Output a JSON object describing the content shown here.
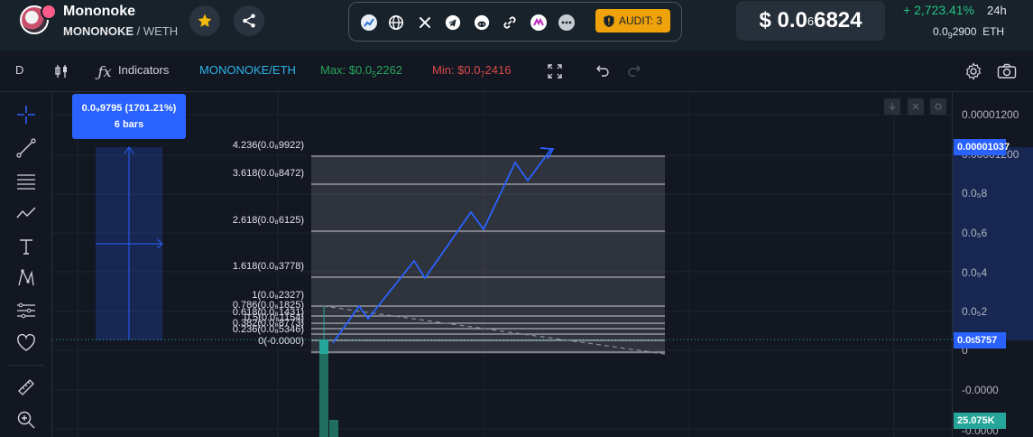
{
  "header": {
    "token_name": "Mononoke",
    "pair_base": "MONONOKE",
    "pair_sep": " / ",
    "pair_quote": "WETH",
    "audit_label": "AUDIT: 3",
    "price_prefix": "$ 0.0",
    "price_sub": "6",
    "price_main": "6824",
    "change": "+ 2,723.41%",
    "change_period": "24h",
    "eth_prefix": "0.0",
    "eth_sub": "9",
    "eth_main": "2900",
    "eth_unit": "ETH",
    "socials": [
      "chart-icon",
      "globe-icon",
      "x-icon",
      "telegram-icon",
      "reddit-icon",
      "link-icon",
      "brand-icon",
      "more-icon"
    ]
  },
  "toolbar": {
    "interval": "D",
    "indicators": "Indicators",
    "pair": "MONONOKE/ETH",
    "max_prefix": "Max: $0.0",
    "max_sub": "5",
    "max_main": "2262",
    "min_prefix": "Min: $0.0",
    "min_sub": "7",
    "min_main": "2416"
  },
  "measure": {
    "line1": "0.0₉9795 (1701.21%)",
    "line2": "6 bars"
  },
  "fib_levels": [
    {
      "label": "4.236(0.0₈9922)"
    },
    {
      "label": "3.618(0.0₈8472)"
    },
    {
      "label": "2.618(0.0₈6125)"
    },
    {
      "label": "1.618(0.0₈3778)"
    },
    {
      "label": "1(0.0₈2327)"
    },
    {
      "label": "0.786(0.0₈1825)"
    },
    {
      "label": "0.618(0.0₈1431)"
    },
    {
      "label": "0.5(0.0₈1154)"
    },
    {
      "label": "0.382(0.0₈8773)"
    },
    {
      "label": "0.236(0.0₈5346)"
    },
    {
      "label": "0(-0.0000)"
    }
  ],
  "axis": {
    "labels": [
      "0.00001200",
      "0.0₅8",
      "0.0₅6",
      "0.0₅4",
      "0.0₅2",
      "0",
      "-0.0000",
      "-0.0000"
    ],
    "tag_top": "0.00001037",
    "tag_mid_prefix": "0.0",
    "tag_mid_sub": "5",
    "tag_mid_main": "5757",
    "tag_volume": "25.075K",
    "colors": {
      "tag_blue": "#2962ff",
      "tag_green": "#26a69a"
    }
  },
  "colors": {
    "accent": "#2962ff",
    "positive": "#26c281",
    "negative": "#d94a4a",
    "audit": "#f0a20b"
  }
}
